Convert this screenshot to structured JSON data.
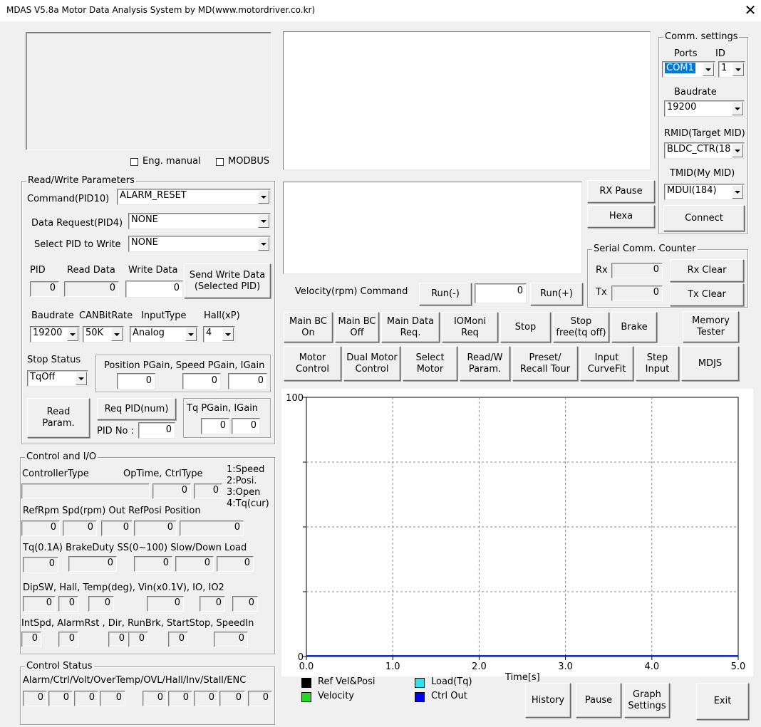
{
  "window": {
    "title": "MDAS V5.8a Motor Data Analysis System by MD(www.motordriver.co.kr)",
    "close": "✕"
  },
  "top_left": {
    "eng_manual": "Eng. manual",
    "modbus": "MODBUS"
  },
  "comm": {
    "title": "Comm. settings",
    "ports_label": "Ports",
    "id_label": "ID",
    "port_value": "COM1",
    "id_value": "1",
    "baud_label": "Baudrate",
    "baud_value": "19200",
    "rmid_label": "RMID(Target MID)",
    "rmid_value": "BLDC_CTR(18",
    "tmid_label": "TMID(My MID)",
    "tmid_value": "MDUI(184)",
    "connect": "Connect"
  },
  "rx_pause": "RX Pause",
  "hexa": "Hexa",
  "serial": {
    "title": "Serial Comm. Counter",
    "rx_label": "Rx",
    "tx_label": "Tx",
    "rx_value": "0",
    "tx_value": "0",
    "rx_clear": "Rx Clear",
    "tx_clear": "Tx Clear"
  },
  "velocity": {
    "label": "Velocity(rpm) Command",
    "run_minus": "Run(-)",
    "value": "0",
    "run_plus": "Run(+)"
  },
  "row1_buttons": [
    "Main BC\nOn",
    "Main BC\nOff",
    "Main Data\nReq.",
    "IOMoni\nReq",
    "Stop",
    "Stop\nfree(tq off)",
    "Brake",
    "Memory\nTester"
  ],
  "row2_buttons": [
    "Motor\nControl",
    "Dual Motor\nControl",
    "Select\nMotor",
    "Read/W\nParam.",
    "Preset/\nRecall Tour",
    "Input\nCurveFit",
    "Step\nInput",
    "MDJS"
  ],
  "rw": {
    "title": "Read/Write Parameters",
    "command_label": "Command(PID10)",
    "command_value": "ALARM_RESET",
    "data_req_label": "Data Request(PID4)",
    "data_req_value": "NONE",
    "select_pid_label": "Select PID to Write",
    "select_pid_value": "NONE",
    "pid_label": "PID",
    "read_data_label": "Read Data",
    "write_data_label": "Write Data",
    "pid_value": "0",
    "read_value": "0",
    "write_value": "0",
    "send_write": "Send Write Data\n(Selected PID)",
    "baud_label": "Baudrate",
    "canbit_label": "CANBitRate",
    "input_type_label": "InputType",
    "hall_label": "Hall(xP)",
    "baud_value": "19200",
    "canbit_value": "50K",
    "input_type_value": "Analog",
    "hall_value": "4",
    "stop_status_label": "Stop Status",
    "stop_status_value": "TqOff",
    "gain_label": "Position PGain, Speed PGain, IGain",
    "gain_values": [
      "0",
      "0",
      "0"
    ],
    "read_param": "Read\nParam.",
    "req_pid": "Req PID(num)",
    "pid_no_label": "PID No :",
    "pid_no_value": "0",
    "tq_gain_label": "Tq PGain, IGain",
    "tq_gain_values": [
      "0",
      "0"
    ]
  },
  "control_io": {
    "title": "Control and I/O",
    "controller_type_label": "ControllerType",
    "optime_label": "OpTime,  CtrlType",
    "optime_value": "0",
    "ctrltype_value": "0",
    "ctrl_legend": [
      "1:Speed",
      "2:Posi.",
      "3:Open",
      "4:Tq(cur)"
    ],
    "row2_label": "RefRpm  Spd(rpm)  Out  RefPosi     Position",
    "row2_values": [
      "0",
      "0",
      "0",
      "0",
      "0"
    ],
    "row3_label": "Tq(0.1A)  BrakeDuty  SS(0~100)  Slow/Down  Load",
    "row3_values": [
      "0",
      "0",
      "0",
      "0",
      "0"
    ],
    "row4_label": "DipSW, Hall,   Temp(deg), Vin(x0.1V),     IO,     IO2",
    "row4_values": [
      "0",
      "0",
      "0",
      "0",
      "0",
      "0"
    ],
    "row5_label": "IntSpd, AlarmRst , Dir, RunBrk, StartStop, SpeedIn",
    "row5_values": [
      "0",
      "0",
      "0",
      "0",
      "0",
      "0"
    ]
  },
  "control_status": {
    "title": "Control Status",
    "label": "Alarm/Ctrl/Volt/OverTemp/OVL/Hall/Inv/Stall/ENC",
    "values": [
      "0",
      "0",
      "0",
      "0",
      "0",
      "0",
      "0",
      "0",
      "0"
    ]
  },
  "chart_data": {
    "type": "line",
    "title": "",
    "xlabel": "Time[s]",
    "ylabel": "",
    "xlim": [
      0,
      5
    ],
    "ylim": [
      0,
      100
    ],
    "x_ticks": [
      "0.0",
      "1.0",
      "2.0",
      "3.0",
      "4.0",
      "5.0"
    ],
    "y_ticks": [
      "0",
      "100"
    ],
    "grid": true,
    "series": [
      {
        "name": "Ref Vel&Posi",
        "color": "#000000",
        "x": [
          0,
          5
        ],
        "y": [
          0,
          0
        ]
      },
      {
        "name": "Velocity",
        "color": "#22d822",
        "x": [
          0,
          5
        ],
        "y": [
          0,
          0
        ]
      },
      {
        "name": "Load(Tq)",
        "color": "#33e0e8",
        "x": [
          0,
          5
        ],
        "y": [
          0,
          0
        ]
      },
      {
        "name": "Ctrl Out",
        "color": "#0000ff",
        "x": [
          0,
          5
        ],
        "y": [
          0,
          0
        ]
      }
    ]
  },
  "bottom_buttons": {
    "history": "History",
    "pause": "Pause",
    "graph_settings": "Graph\nSettings",
    "exit": "Exit"
  }
}
